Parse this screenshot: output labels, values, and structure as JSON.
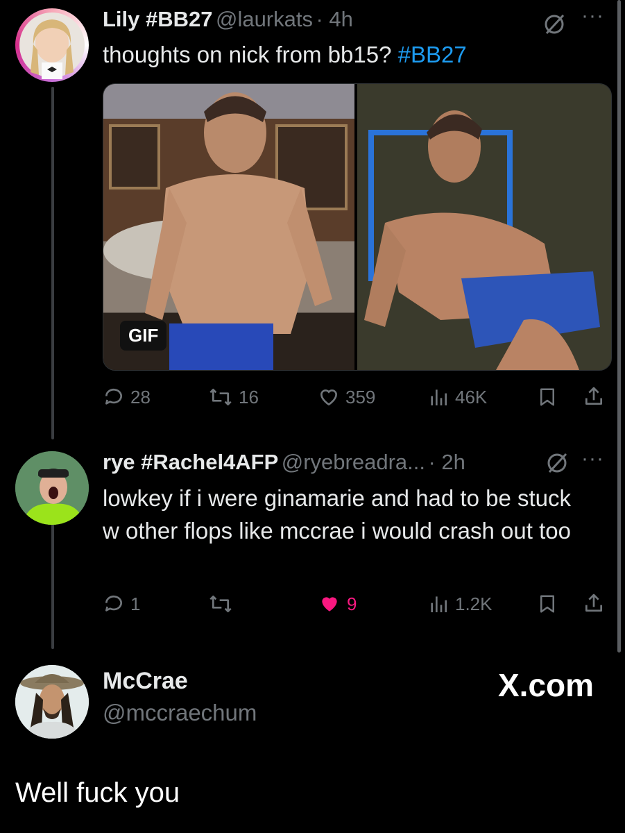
{
  "post1": {
    "name": "Lily #BB27",
    "handle": "@laurkats",
    "time": "· 4h",
    "text": "thoughts on nick from bb15? ",
    "hashtag": "#BB27",
    "gif_badge": "GIF",
    "replies": "28",
    "reposts": "16",
    "likes": "359",
    "views": "46K"
  },
  "post2": {
    "name": "rye #Rachel4AFP",
    "handle": "@ryebreadra...",
    "time": "· 2h",
    "text": "lowkey if i were ginamarie and had to be stuck w other flops like mccrae i would crash out too",
    "replies": "1",
    "likes": "9",
    "views": "1.2K"
  },
  "quote": {
    "name": "McCrae",
    "handle": "@mccraechum",
    "watermark": "X.com",
    "text": "Well fuck you"
  },
  "colors": {
    "hashtag": "#1d9bf0",
    "liked": "#f91880",
    "muted": "#71767b"
  },
  "icons": [
    "grok-slash-icon",
    "more-icon",
    "reply-icon",
    "repost-icon",
    "heart-icon",
    "views-icon",
    "bookmark-icon",
    "share-icon"
  ]
}
